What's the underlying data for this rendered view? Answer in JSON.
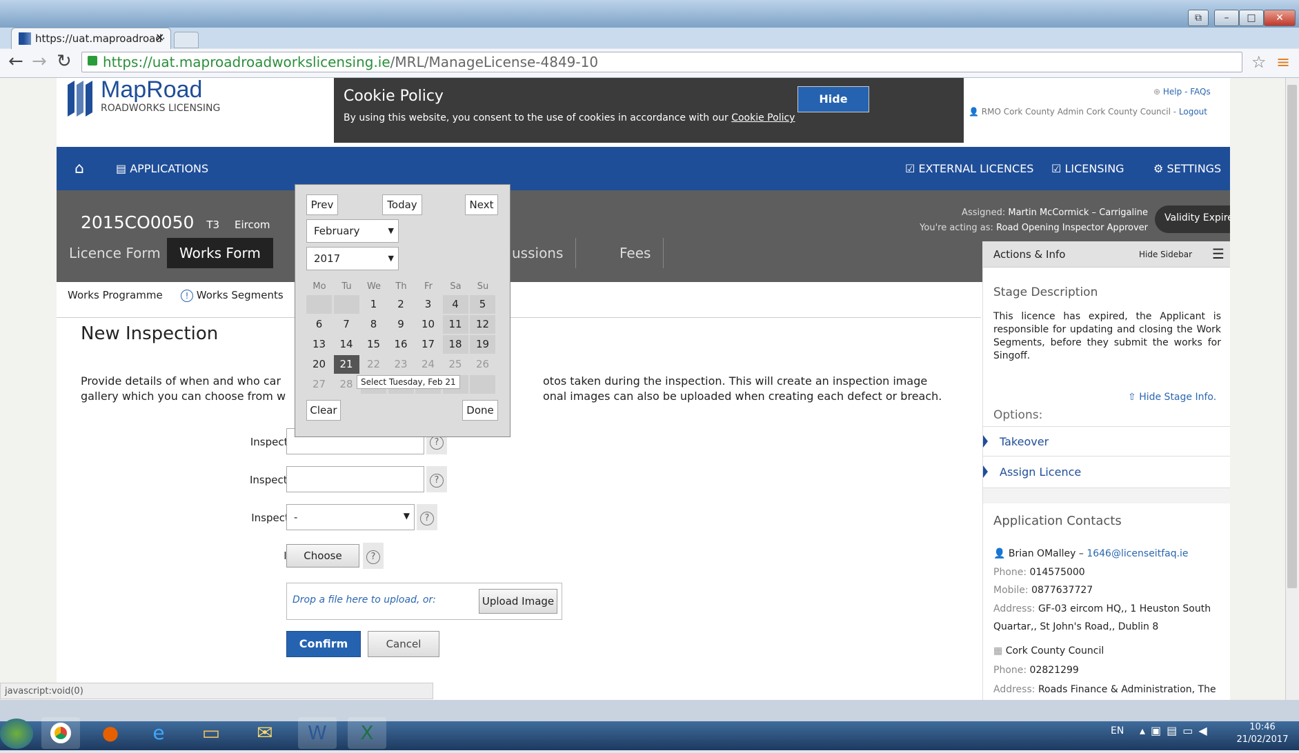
{
  "browser": {
    "tab_title": "https://uat.maproadroad·",
    "url_host": "https://uat.maproadroadworkslicensing.ie",
    "url_path": "/MRL/ManageLicense-4849-10",
    "status_url": "javascript:void(0)"
  },
  "header": {
    "logo_name": "MapRoad",
    "logo_sub": "ROADWORKS LICENSING",
    "help_link": "Help - FAQs",
    "user": "RMO Cork County Admin Cork County Council",
    "logout": "Logout"
  },
  "cookie": {
    "title": "Cookie Policy",
    "text": "By using this website, you consent to the use of cookies in accordance with our",
    "link": "Cookie Policy",
    "hide": "Hide"
  },
  "nav": {
    "applications": "APPLICATIONS",
    "external": "EXTERNAL LICENCES",
    "licensing": "LICENSING",
    "settings": "SETTINGS"
  },
  "licence": {
    "ref": "2015CO0050",
    "type": "T3",
    "company": "Eircom",
    "assigned_label": "Assigned:",
    "assigned": "Martin McCormick – Carrigaline",
    "acting_label": "You're acting as:",
    "acting": "Road Opening Inspector Approver",
    "validity": "Validity Expired"
  },
  "tabs": {
    "licence_form": "Licence Form",
    "works_form": "Works Form",
    "discussions_partial": "ussions",
    "fees": "Fees"
  },
  "subtabs": {
    "programme": "Works Programme",
    "segments": "Works Segments"
  },
  "form": {
    "heading": "New Inspection",
    "desc_left_1": "Provide details of when and who car",
    "desc_right_1": "otos taken during the inspection. This will create an inspection image",
    "desc_left_2": "gallery which you can choose from w",
    "desc_right_2": "onal images can also be uploaded when creating each defect or breach.",
    "date_label": "Inspection Date:",
    "time_label": "Inspection Time:",
    "type_label": "Inspection Type:",
    "type_value": "-",
    "inspector_label": "Inspector:",
    "choose": "Choose",
    "drop_text": "Drop a file here to upload, or:",
    "upload": "Upload Image",
    "confirm": "Confirm",
    "cancel": "Cancel"
  },
  "datepicker": {
    "prev": "Prev",
    "today": "Today",
    "next": "Next",
    "month": "February",
    "year": "2017",
    "weekdays": [
      "Mo",
      "Tu",
      "We",
      "Th",
      "Fr",
      "Sa",
      "Su"
    ],
    "days": [
      "1",
      "2",
      "3",
      "4",
      "5",
      "6",
      "7",
      "8",
      "9",
      "10",
      "11",
      "12",
      "13",
      "14",
      "15",
      "16",
      "17",
      "18",
      "19",
      "20",
      "21",
      "22",
      "23",
      "24",
      "25",
      "26",
      "27",
      "28"
    ],
    "selected": "21",
    "tooltip": "Select Tuesday, Feb 21",
    "clear": "Clear",
    "done": "Done"
  },
  "sidebar": {
    "title": "Actions & Info",
    "hide": "Hide Sidebar",
    "stage_title": "Stage Description",
    "stage_text": "This licence has expired, the Applicant is responsible for updating and closing the Work Segments, before they submit the works for Singoff.",
    "hide_stage": "Hide Stage Info.",
    "options": "Options:",
    "takeover": "Takeover",
    "assign": "Assign Licence",
    "contacts_title": "Application Contacts",
    "c1_name": "Brian OMalley –",
    "c1_email": "1646@licenseitfaq.ie",
    "phone_label": "Phone:",
    "c1_phone": "014575000",
    "mobile_label": "Mobile:",
    "c1_mobile": "0877637727",
    "address_label": "Address:",
    "c1_address1": "GF-03 eircom HQ,, 1 Heuston South",
    "c1_address2": "Quartar,, St John's Road,, Dublin 8",
    "c2_name": "Cork County Council",
    "c2_phone": "02821299",
    "c2_address": "Roads Finance & Administration, The"
  },
  "taskbar": {
    "lang": "EN",
    "time": "10:46",
    "date": "21/02/2017"
  },
  "colors": {
    "nav": "#1f4e98",
    "link": "#2a66b0",
    "confirm": "#2563b0",
    "validity": "#2ecc71"
  }
}
